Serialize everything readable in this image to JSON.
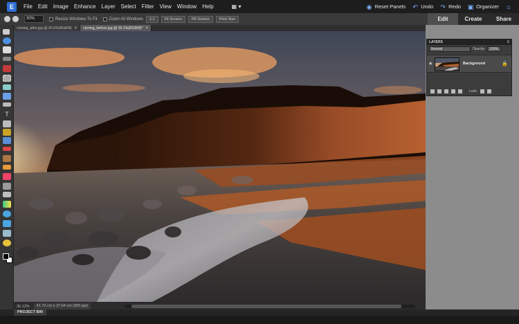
{
  "menu": {
    "logo": "E",
    "items": [
      "File",
      "Edit",
      "Image",
      "Enhance",
      "Layer",
      "Select",
      "Filter",
      "View",
      "Window",
      "Help"
    ],
    "reset_panels": "Reset Panels",
    "undo": "Undo",
    "redo": "Redo",
    "organizer": "Organizer"
  },
  "options": {
    "zoom_value": "30%",
    "resize_windows": "Resize Windows To Fit",
    "zoom_all": "Zoom All Windows",
    "btn_1to1": "1:1",
    "btn_fit": "Fit Screen",
    "btn_fill": "Fill Screen",
    "btn_print": "Print Size"
  },
  "mode_tabs": {
    "edit": "Edit",
    "create": "Create",
    "share": "Share"
  },
  "doc_tabs": [
    {
      "label": "cloning_after.jpg @ 26.6%(RGB/8)"
    },
    {
      "label": "cloning_before.jpg @ 30.1%(RGB/8)*"
    }
  ],
  "status": {
    "zoom": "30.12%",
    "dimensions": "41.72 cm x 27.64 cm (300 ppi)"
  },
  "project_bin": {
    "label": "PROJECT BIN"
  },
  "layers": {
    "title": "LAYERS",
    "blend_mode": "Normal",
    "opacity_label": "Opacity:",
    "opacity_value": "100%",
    "layer_name": "Background",
    "lock_label": "Lock:"
  },
  "colors": {
    "menubar": "#1d1d1d",
    "panel_grey": "#8c8c8c",
    "accent_blue": "#2f6fd4",
    "sky_orange": "#f2a85a"
  }
}
